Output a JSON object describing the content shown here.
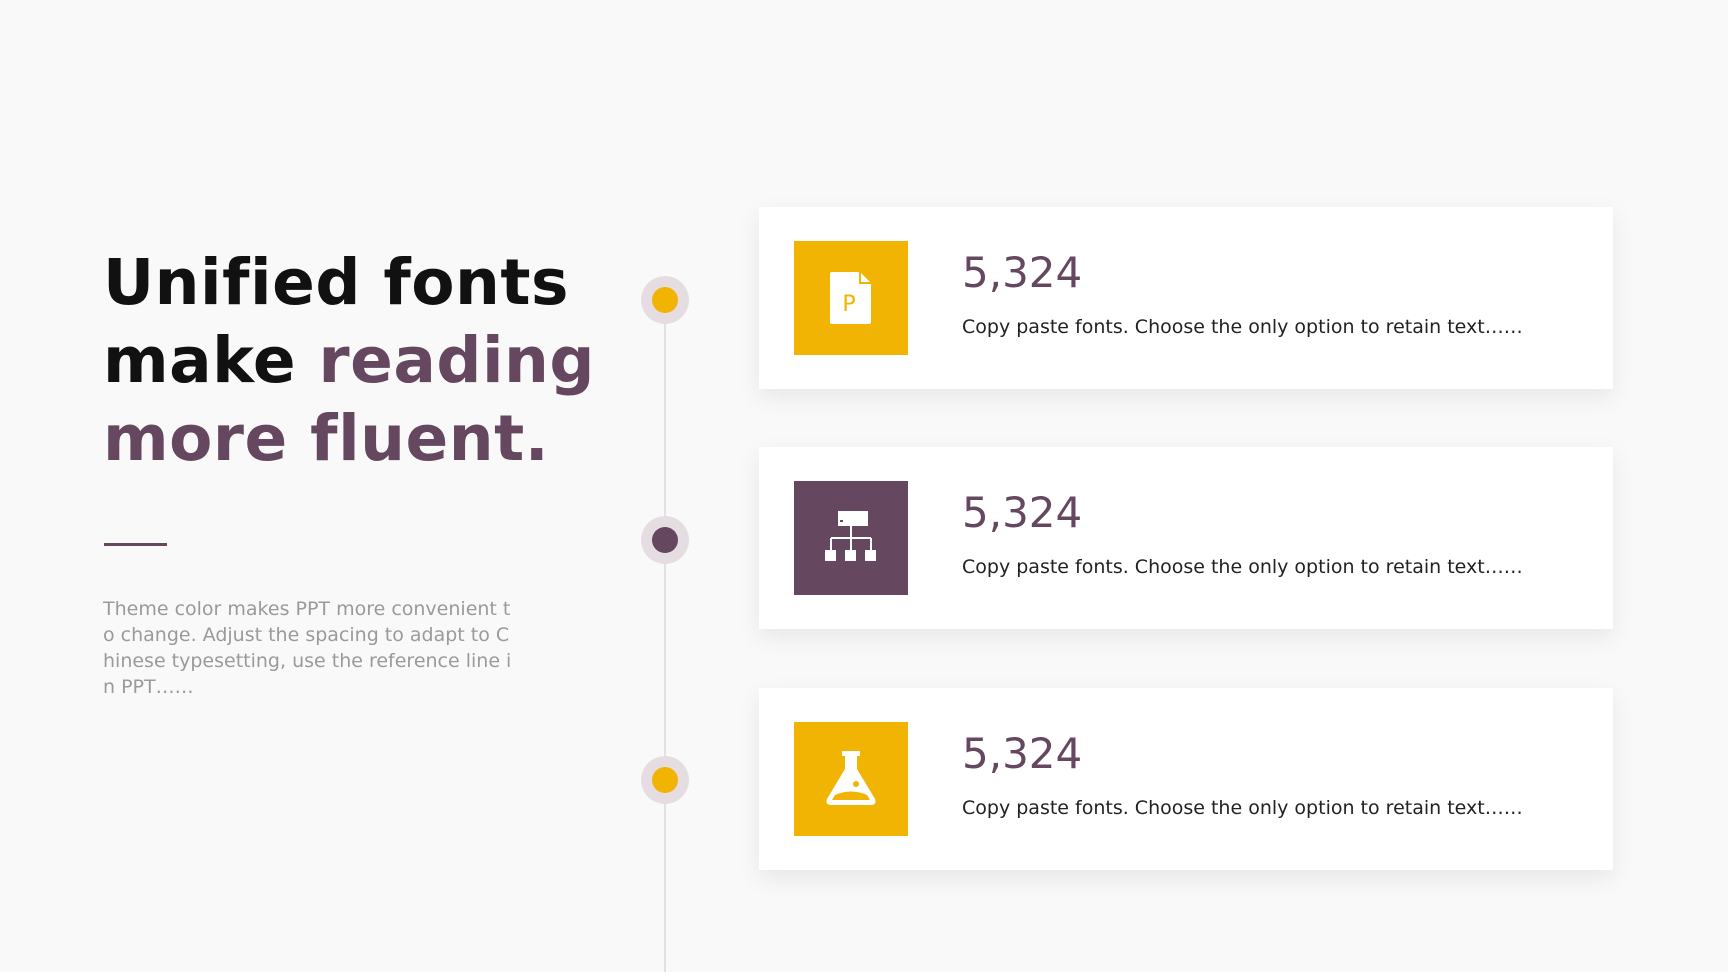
{
  "headline": {
    "line1": "Unified fonts",
    "line2_plain": "make ",
    "line2_accent": "reading",
    "line3_accent": "more fluent."
  },
  "description": "Theme color makes PPT more convenient to change. Adjust the spacing to adapt to Chinese typesetting, use the reference line in PPT……",
  "colors": {
    "accent": "#654860",
    "highlight": "#f1b403",
    "background": "#f9f9f9"
  },
  "items": [
    {
      "value": "5,324",
      "text": "Copy paste fonts. Choose the only option to retain text……",
      "icon": "ppt-file-icon",
      "icon_letter": "P",
      "color": "#f1b403"
    },
    {
      "value": "5,324",
      "text": "Copy paste fonts. Choose the only option to retain text……",
      "icon": "org-chart-icon",
      "color": "#654860"
    },
    {
      "value": "5,324",
      "text": "Copy paste fonts. Choose the only option to retain text……",
      "icon": "flask-icon",
      "color": "#f1b403"
    }
  ]
}
